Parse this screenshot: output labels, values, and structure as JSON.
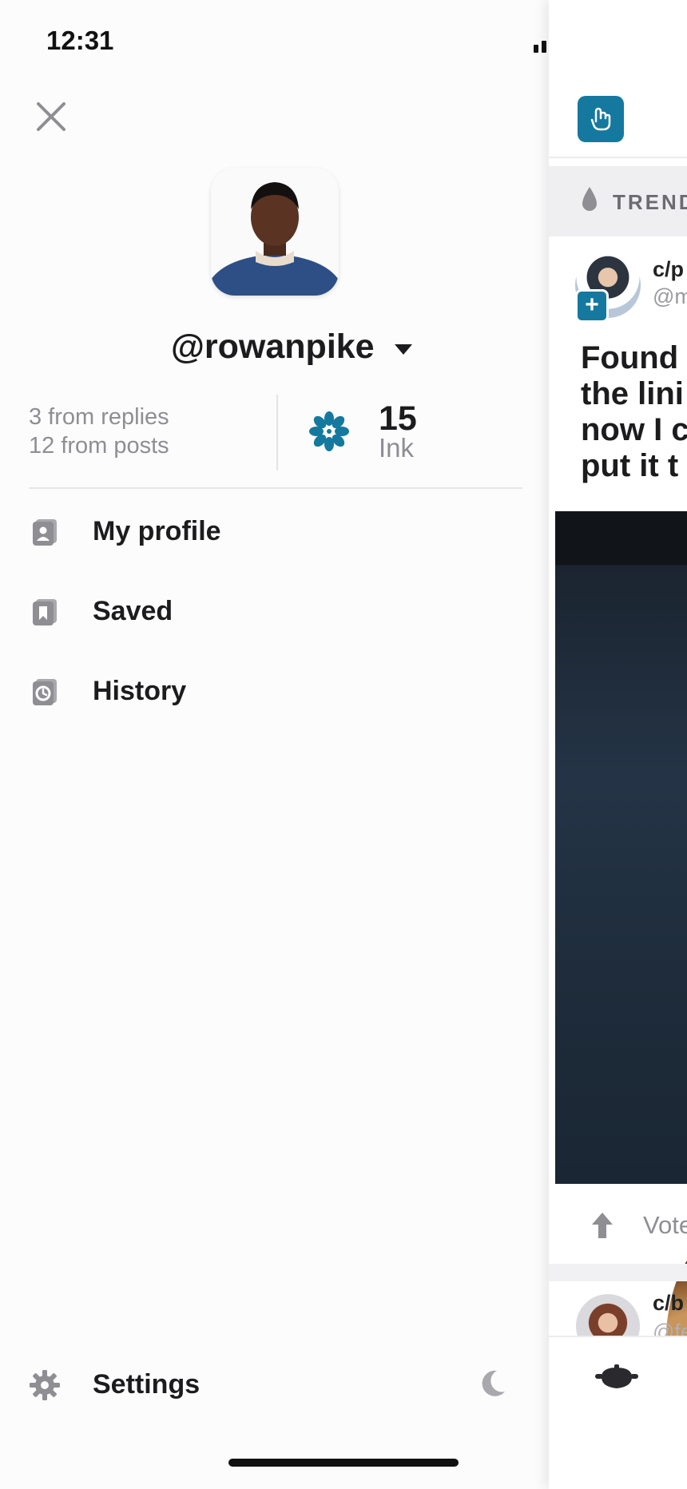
{
  "status": {
    "time": "12:31"
  },
  "drawer": {
    "username": "@rowanpike",
    "stats": {
      "replies": "3 from replies",
      "posts": "12 from posts",
      "ink_value": "15",
      "ink_label": "Ink"
    },
    "menu": [
      {
        "label": "My profile",
        "icon": "profile-card-icon"
      },
      {
        "label": "Saved",
        "icon": "bookmark-icon"
      },
      {
        "label": "History",
        "icon": "history-clock-icon"
      }
    ],
    "settings_label": "Settings"
  },
  "feed": {
    "trend_label": "TREND",
    "post": {
      "community": "c/p",
      "handle": "@m",
      "title": "Found\nthe lini\nnow I c\nput it t",
      "vote_label": "Vote"
    },
    "post2": {
      "community": "c/b",
      "handle": "@fe"
    }
  },
  "colors": {
    "accent": "#15799f",
    "text": "#1c1c1e",
    "muted": "#8e8e93"
  }
}
